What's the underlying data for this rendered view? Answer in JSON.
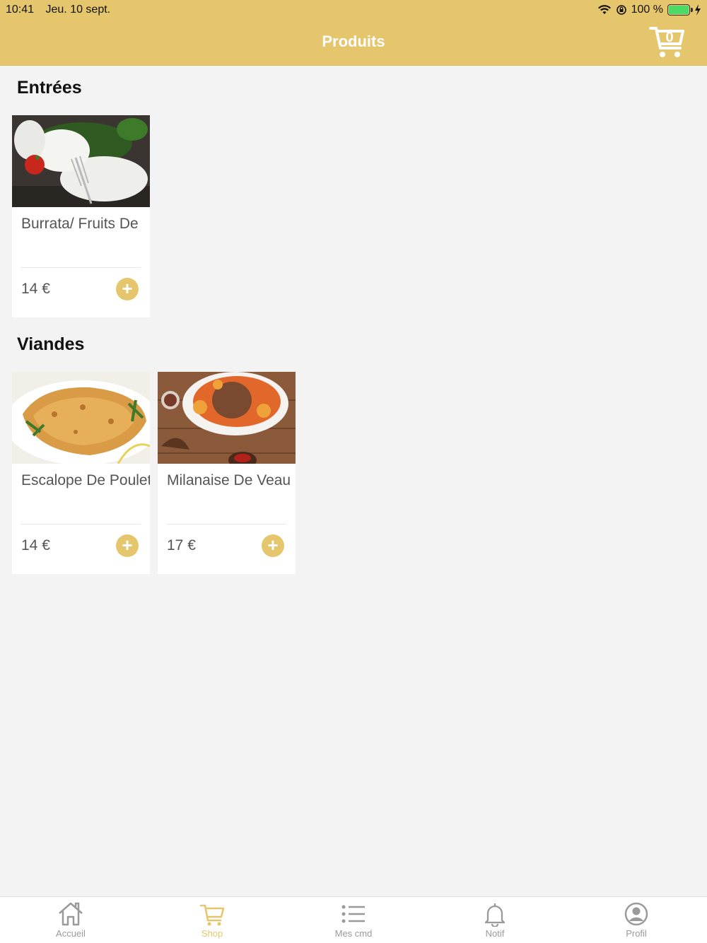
{
  "status": {
    "time": "10:41",
    "date": "Jeu. 10 sept.",
    "battery": "100 %"
  },
  "header": {
    "title": "Produits",
    "cart_count": "0"
  },
  "sections": [
    {
      "title": "Entrées",
      "items": [
        {
          "name": "Burrata/ Fruits De",
          "price": "14 €"
        }
      ]
    },
    {
      "title": "Viandes",
      "items": [
        {
          "name": "Escalope De Poulet",
          "price": "14 €"
        },
        {
          "name": "Milanaise De Veau",
          "price": "17 €"
        }
      ]
    }
  ],
  "tabs": [
    {
      "label": "Accueil",
      "icon": "home-icon"
    },
    {
      "label": "Shop",
      "icon": "cart-icon",
      "active": true
    },
    {
      "label": "Mes cmd",
      "icon": "list-icon"
    },
    {
      "label": "Notif",
      "icon": "bell-icon"
    },
    {
      "label": "Profil",
      "icon": "profile-icon"
    }
  ],
  "colors": {
    "accent": "#e6c66c",
    "background": "#f3f3f3"
  }
}
